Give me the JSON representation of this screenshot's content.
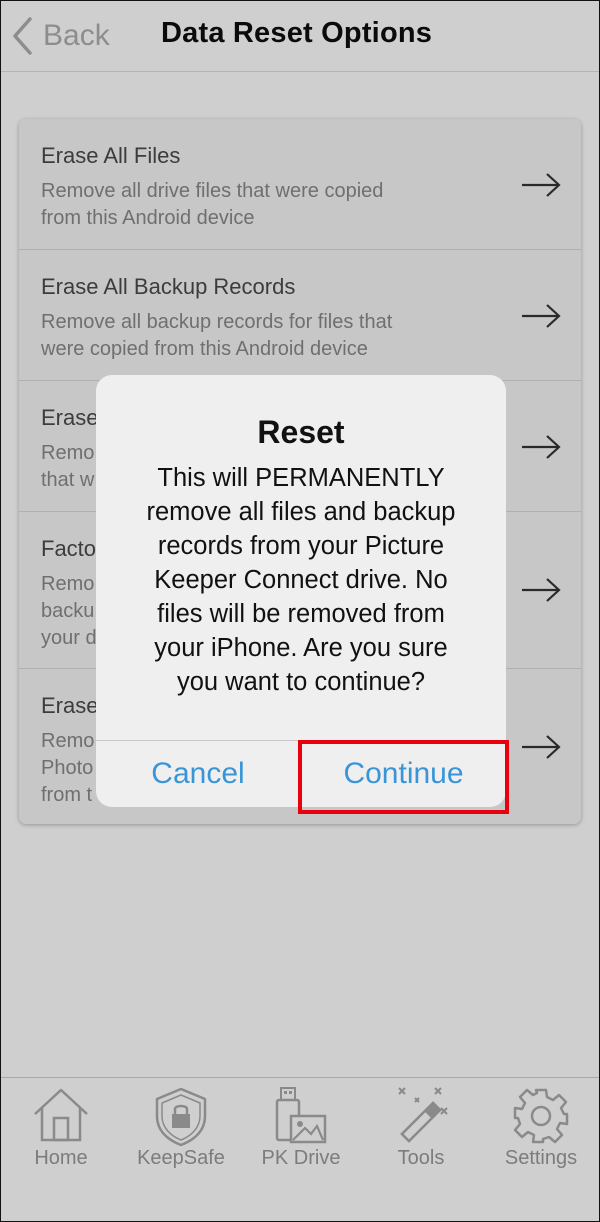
{
  "header": {
    "back_label": "Back",
    "title": "Data Reset Options"
  },
  "options": [
    {
      "title": "Erase All Files",
      "desc_lines": [
        "Remove all drive files that were copied",
        "from this Android device"
      ],
      "arrow_icon": "arrow-right-icon"
    },
    {
      "title": "Erase All Backup Records",
      "desc_lines": [
        "Remove all backup records for files that",
        "were copied from this Android device"
      ],
      "arrow_icon": "arrow-right-icon"
    },
    {
      "title": "Erase",
      "desc_lines": [
        "Remo",
        "that w"
      ],
      "arrow_icon": "arrow-right-icon"
    },
    {
      "title": "Facto",
      "desc_lines": [
        "Remo",
        "backu",
        "your d"
      ],
      "arrow_icon": "arrow-right-icon"
    },
    {
      "title": "Erase",
      "desc_lines": [
        "Remo",
        "Photo",
        "from t"
      ],
      "arrow_icon": "arrow-right-icon"
    }
  ],
  "dialog": {
    "title": "Reset",
    "message_lines": [
      "This will PERMANENTLY",
      "remove all files and backup",
      "records from your Picture",
      "Keeper Connect drive. No",
      "files will be removed from",
      "your iPhone. Are you sure",
      "you want to continue?"
    ],
    "cancel_label": "Cancel",
    "continue_label": "Continue"
  },
  "tabs": [
    {
      "label": "Home",
      "icon": "home-icon"
    },
    {
      "label": "KeepSafe",
      "icon": "shield-lock-icon"
    },
    {
      "label": "PK Drive",
      "icon": "drive-icon"
    },
    {
      "label": "Tools",
      "icon": "magic-wand-icon"
    },
    {
      "label": "Settings",
      "icon": "gear-icon"
    }
  ],
  "colors": {
    "accent_blue": "#3a95d8",
    "highlight_red": "#e8000d",
    "background": "#cfcfcf"
  }
}
